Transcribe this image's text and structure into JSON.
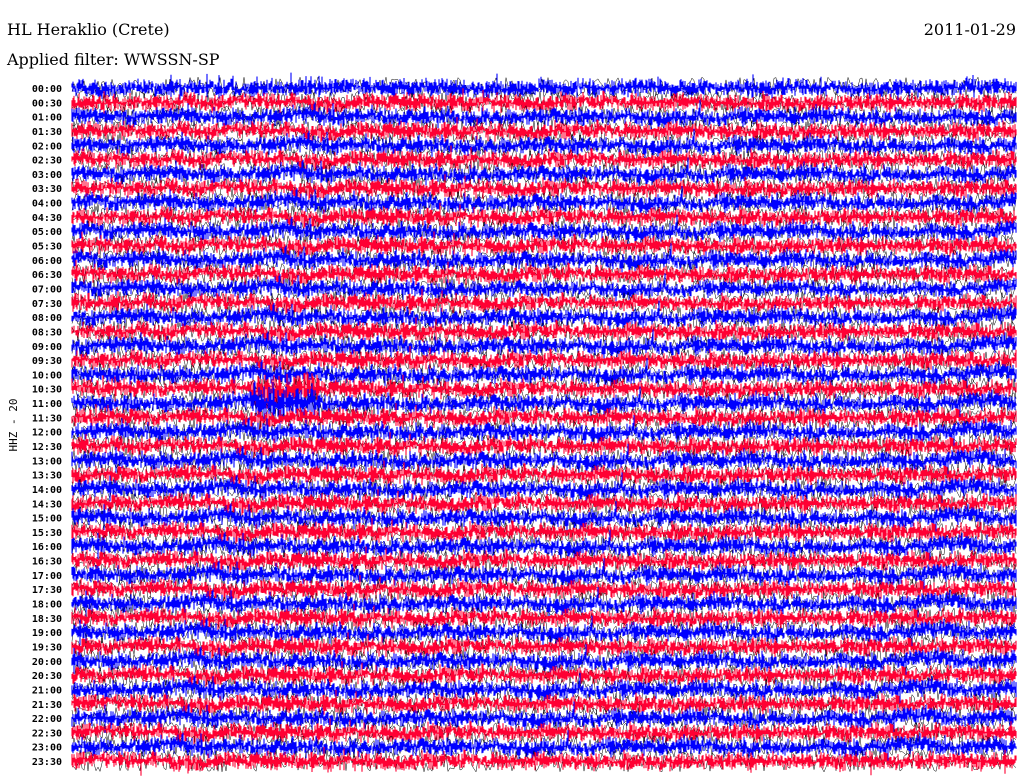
{
  "header": {
    "station": "HL Heraklio (Crete)",
    "date": "2011-01-29",
    "filter": "Applied filter: WWSSN-SP"
  },
  "chart_data": {
    "type": "line",
    "title": "HL Heraklio (Crete)",
    "subtitle": "Applied filter: WWSSN-SP",
    "ylabel": "HHZ - 20",
    "xlabel": "",
    "rows": [
      "00:00",
      "00:30",
      "01:00",
      "01:30",
      "02:00",
      "02:30",
      "03:00",
      "03:30",
      "04:00",
      "04:30",
      "05:00",
      "05:30",
      "06:00",
      "06:30",
      "07:00",
      "07:30",
      "08:00",
      "08:30",
      "09:00",
      "09:30",
      "10:00",
      "10:30",
      "11:00",
      "11:30",
      "12:00",
      "12:30",
      "13:00",
      "13:30",
      "14:00",
      "14:30",
      "15:00",
      "15:30",
      "16:00",
      "16:30",
      "17:00",
      "17:30",
      "18:00",
      "18:30",
      "19:00",
      "19:30",
      "20:00",
      "20:30",
      "21:00",
      "21:30",
      "22:00",
      "22:30",
      "23:00",
      "23:30"
    ],
    "trace_colors": [
      "#0000ff",
      "#ff0033"
    ],
    "grid": false,
    "legend": "none"
  }
}
